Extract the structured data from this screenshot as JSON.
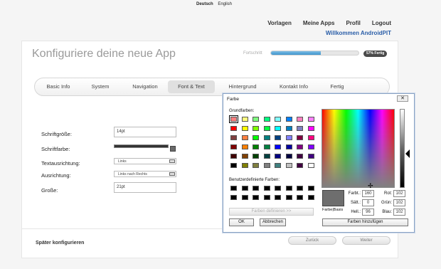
{
  "lang": {
    "german": "Deutsch",
    "english": "English"
  },
  "topnav": {
    "templates": "Vorlagen",
    "my_apps": "Meine Apps",
    "profile": "Profil",
    "logout": "Logout",
    "welcome": "Willkommen AndroidPIT"
  },
  "page": {
    "title": "Konfiguriere deine neue App",
    "progress_label": "Fortschritt",
    "progress_badge": "57% Fertig",
    "progress_value": 0.57
  },
  "tabs": [
    "Basic Info",
    "System",
    "Navigation",
    "Font & Text",
    "Hintergrund",
    "Kontakt Info",
    "Fertig"
  ],
  "active_tab": "Font & Text",
  "form": {
    "font_size_label": "Schriftgröße:",
    "font_size_value": "14pt",
    "font_color_label": "Schriftfarbe:",
    "text_align_label": "Textausrichtung:",
    "text_align_value": "Links",
    "alignment_label": "Ausrichtung:",
    "alignment_value": "Links nach Rechts",
    "size_label": "Große:",
    "size_value": "21pt"
  },
  "footer": {
    "later": "Später konfigurieren",
    "back": "Zurück",
    "next": "Weiter"
  },
  "color_dialog": {
    "title": "Farbe",
    "close": "✕",
    "basic_colors_label": "Grundfarben:",
    "custom_colors_label": "Benutzerdefinierte Farben:",
    "define_colors": "Farben definieren >>",
    "ok": "OK",
    "cancel": "Abbrechen",
    "color_solid": "Farbe|Basis",
    "add_custom": "Farben hinzufügen",
    "hue_label": "Farbt.:",
    "hue": "160",
    "sat_label": "Sätt.:",
    "sat": "0",
    "lum_label": "Hell.:",
    "lum": "96",
    "red_label": "Rot:",
    "red": "102",
    "green_label": "Grün:",
    "green": "102",
    "blue_label": "Blau:",
    "blue": "102",
    "basic_colors": [
      "#ff8080",
      "#ffff80",
      "#80ff80",
      "#00ff80",
      "#80ffff",
      "#0080ff",
      "#ff80c0",
      "#ff80ff",
      "#ff0000",
      "#ffff00",
      "#80ff00",
      "#00ff40",
      "#00ffff",
      "#0080c0",
      "#8080c0",
      "#ff00ff",
      "#804040",
      "#ff8040",
      "#00ff00",
      "#008080",
      "#004080",
      "#8080ff",
      "#800040",
      "#ff0080",
      "#800000",
      "#ff8000",
      "#008000",
      "#008040",
      "#0000ff",
      "#0000a0",
      "#800080",
      "#8000ff",
      "#400000",
      "#804000",
      "#004000",
      "#004040",
      "#000080",
      "#000040",
      "#400040",
      "#400080",
      "#000000",
      "#808000",
      "#808040",
      "#808080",
      "#408080",
      "#c0c0c0",
      "#400040",
      "#ffffff"
    ]
  }
}
